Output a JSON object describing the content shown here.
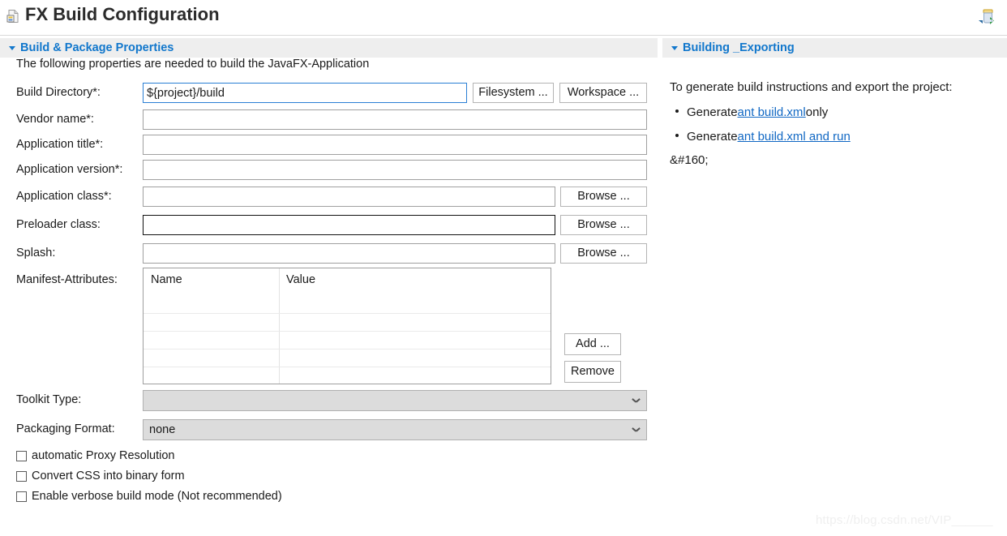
{
  "window": {
    "title": "FX Build Configuration",
    "title_icon": "fx-build-config-document-icon",
    "action_icon": "export-jar-icon"
  },
  "left_section": {
    "header_label": "Build & Package Properties",
    "lead_text": "The following properties are needed to build the JavaFX-Application",
    "fields": [
      {
        "label": "Build Directory*:",
        "value": "${project}/build",
        "placeholder": "",
        "state": "focused",
        "buttons": [
          "Filesystem ...",
          "Workspace ..."
        ]
      },
      {
        "label": "Vendor name*:",
        "value": "",
        "placeholder": "",
        "state": "normal",
        "buttons": []
      },
      {
        "label": "Application title*:",
        "value": "",
        "placeholder": "",
        "state": "normal",
        "buttons": []
      },
      {
        "label": "Application version*:",
        "value": "",
        "placeholder": "",
        "state": "normal",
        "buttons": []
      },
      {
        "label": "Application class*:",
        "value": "",
        "placeholder": "",
        "state": "normal",
        "buttons": [
          "Browse ..."
        ]
      },
      {
        "label": "Preloader class:",
        "value": "",
        "placeholder": "",
        "state": "hovered",
        "buttons": [
          "Browse ..."
        ]
      },
      {
        "label": "Splash:",
        "value": "",
        "placeholder": "",
        "state": "normal",
        "buttons": [
          "Browse ..."
        ]
      }
    ],
    "buttons": {
      "filesystem": "Filesystem ...",
      "workspace": "Workspace ...",
      "browse_app_class": "Browse ...",
      "browse_preloader": "Browse ...",
      "browse_splash": "Browse ...",
      "add": "Add ...",
      "remove": "Remove"
    },
    "manifest": {
      "label": "Manifest-Attributes:",
      "columns": [
        "Name",
        "Value"
      ],
      "rows": [
        {
          "name": "",
          "value": ""
        },
        {
          "name": "",
          "value": ""
        },
        {
          "name": "",
          "value": ""
        },
        {
          "name": "",
          "value": ""
        }
      ]
    },
    "combos": [
      {
        "label": "Toolkit Type:",
        "value": ""
      },
      {
        "label": "Packaging Format:",
        "value": "none"
      }
    ],
    "checkboxes": [
      {
        "label": "automatic Proxy Resolution",
        "checked": false
      },
      {
        "label": "Convert CSS into binary form",
        "checked": false
      },
      {
        "label": "Enable verbose build mode (Not recommended)",
        "checked": false
      }
    ]
  },
  "right_section": {
    "header_label": "Building _Exporting",
    "intro": "To generate build instructions and export the project:",
    "bullets": [
      {
        "prefix": "Generate ",
        "link": "ant build.xml",
        "suffix": " only"
      },
      {
        "prefix": "Generate ",
        "link": "ant build.xml and run",
        "suffix": ""
      }
    ],
    "trailing_text": "&#160;"
  },
  "watermark": "https://blog.csdn.net/VIP______",
  "colors": {
    "accent": "#1177cc",
    "link": "#1168c4",
    "header_bg": "#eeeeee",
    "combo_bg": "#dcdcdc",
    "focus_border": "#2a7fd4"
  }
}
